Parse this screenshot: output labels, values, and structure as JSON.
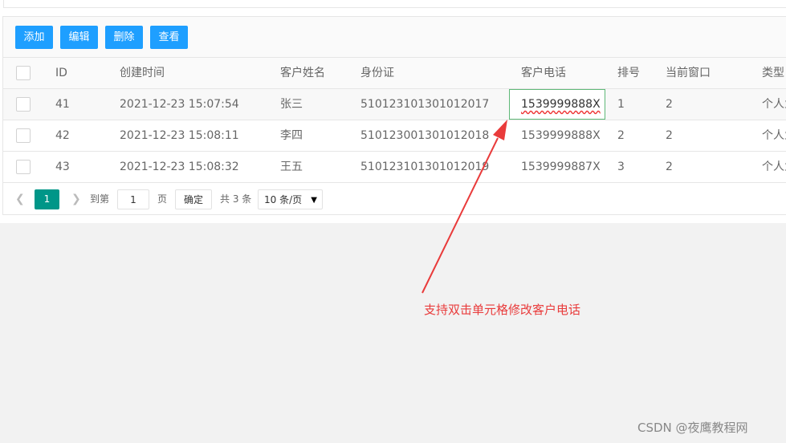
{
  "toolbar": {
    "add_label": "添加",
    "edit_label": "编辑",
    "delete_label": "删除",
    "view_label": "查看",
    "button_color": "#1e9fff"
  },
  "table": {
    "headers": [
      "ID",
      "创建时间",
      "客户姓名",
      "身份证",
      "客户电话",
      "排号",
      "当前窗口",
      "类型"
    ],
    "rows": [
      {
        "id": "41",
        "created": "2021-12-23 15:07:54",
        "name": "张三",
        "id_card": "510123101301012017",
        "phone": "1539999888X",
        "queue": "1",
        "window": "2",
        "type": "个人业"
      },
      {
        "id": "42",
        "created": "2021-12-23 15:08:11",
        "name": "李四",
        "id_card": "510123001301012018",
        "phone": "1539999888X",
        "queue": "2",
        "window": "2",
        "type": "个人业"
      },
      {
        "id": "43",
        "created": "2021-12-23 15:08:32",
        "name": "王五",
        "id_card": "510123101301012019",
        "phone": "1539999887X",
        "queue": "3",
        "window": "2",
        "type": "个人业"
      }
    ]
  },
  "pager": {
    "current_page": "1",
    "goto_prefix": "到第",
    "goto_value": "1",
    "goto_suffix": "页",
    "confirm_label": "确定",
    "total_label": "共 3 条",
    "page_size_label": "10 条/页",
    "current_color": "#009688"
  },
  "annotation": {
    "text": "支持双击单元格修改客户电话",
    "color": "#e93b3b"
  },
  "watermark": "CSDN @夜鹰教程网"
}
